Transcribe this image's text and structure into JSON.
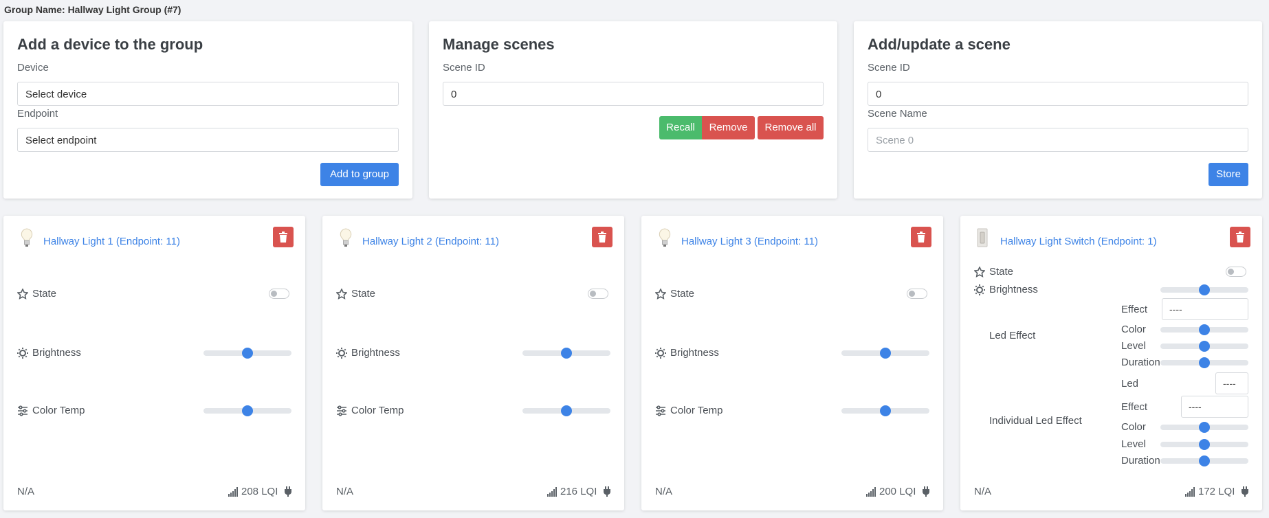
{
  "header": {
    "group_name": "Group Name: Hallway Light Group (#7)"
  },
  "add_device": {
    "title": "Add a device to the group",
    "device_label": "Device",
    "device_value": "Select device",
    "endpoint_label": "Endpoint",
    "endpoint_value": "Select endpoint",
    "add_button": "Add to group"
  },
  "manage_scenes": {
    "title": "Manage scenes",
    "scene_id_label": "Scene ID",
    "scene_id_value": "0",
    "recall_button": "Recall",
    "remove_button": "Remove",
    "remove_all_button": "Remove all"
  },
  "add_scene": {
    "title": "Add/update a scene",
    "scene_id_label": "Scene ID",
    "scene_id_value": "0",
    "scene_name_label": "Scene Name",
    "scene_name_placeholder": "Scene 0",
    "store_button": "Store"
  },
  "devices": [
    {
      "title": "Hallway Light 1 (Endpoint: 11)",
      "state_label": "State",
      "brightness_label": "Brightness",
      "color_temp_label": "Color Temp",
      "brightness_level": 0.5,
      "color_temp_level": 0.5,
      "status": "N/A",
      "lqi": "208 LQI"
    },
    {
      "title": "Hallway Light 2 (Endpoint: 11)",
      "state_label": "State",
      "brightness_label": "Brightness",
      "color_temp_label": "Color Temp",
      "brightness_level": 0.5,
      "color_temp_level": 0.5,
      "status": "N/A",
      "lqi": "216 LQI"
    },
    {
      "title": "Hallway Light 3 (Endpoint: 11)",
      "state_label": "State",
      "brightness_label": "Brightness",
      "color_temp_label": "Color Temp",
      "brightness_level": 0.5,
      "color_temp_level": 0.5,
      "status": "N/A",
      "lqi": "200 LQI"
    }
  ],
  "switch": {
    "title": "Hallway Light Switch (Endpoint: 1)",
    "state_label": "State",
    "brightness_label": "Brightness",
    "led_effect_label": "Led Effect",
    "effect_label": "Effect",
    "effect_value": "----",
    "color_label": "Color",
    "level_label": "Level",
    "duration_label": "Duration",
    "individual_led_effect_label": "Individual Led Effect",
    "led_label": "Led",
    "led_value": "----",
    "ind_effect_label": "Effect",
    "ind_effect_value": "----",
    "ind_color_label": "Color",
    "ind_level_label": "Level",
    "ind_duration_label": "Duration",
    "status": "N/A",
    "lqi": "172 LQI"
  },
  "colors": {
    "accent": "#3d83e6",
    "danger": "#d9534f",
    "success": "#4bbb6c"
  },
  "icons": {
    "bulb": "bulb-icon",
    "switch": "wall-switch-icon",
    "trash": "trash-icon",
    "state": "star-icon",
    "brightness": "sun-icon",
    "color_temp": "sliders-icon",
    "signal": "signal-icon",
    "plug": "plug-icon"
  }
}
